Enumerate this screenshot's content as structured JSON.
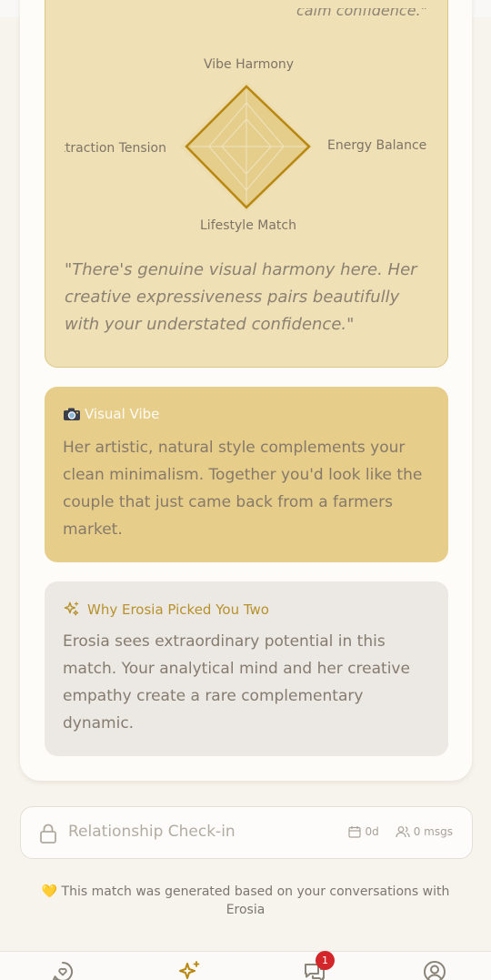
{
  "previous_quote_tail": "calm confidence.\"",
  "radar": {
    "axes": {
      "top": "Vibe Harmony",
      "right": "Energy Balance",
      "bottom": "Lifestyle Match",
      "left": "Attraction Tension"
    },
    "quote": "\"There's genuine visual harmony here. Her creative expressiveness pairs beautifully with your understated confidence.\"",
    "accent_color": "#b8870f",
    "fill_color": "#e6cf8e"
  },
  "visual_vibe": {
    "icon": "camera-icon",
    "title": "Visual Vibe",
    "text": "Her artistic, natural style complements your clean minimalism. Together you'd look like the couple that just came back from a farmers market."
  },
  "why_picked": {
    "icon": "sparkles-icon",
    "title": "Why Erosia Picked You Two",
    "text": "Erosia sees extraordinary potential in this match. Your analytical mind and her creative empathy create a rare complementary dynamic."
  },
  "checkin": {
    "icon": "lock-icon",
    "label": "Relationship Check-in",
    "days": "0d",
    "messages": "0 msgs"
  },
  "footer_note": "💛 This match was generated based on your conversations with Erosia",
  "nav": {
    "items": [
      {
        "name": "chat-heart-icon"
      },
      {
        "name": "sparkles-icon",
        "active": true
      },
      {
        "name": "messages-icon",
        "badge": "1"
      },
      {
        "name": "profile-icon"
      }
    ],
    "active_color": "#b8870f",
    "badge_color": "#d2262a"
  }
}
